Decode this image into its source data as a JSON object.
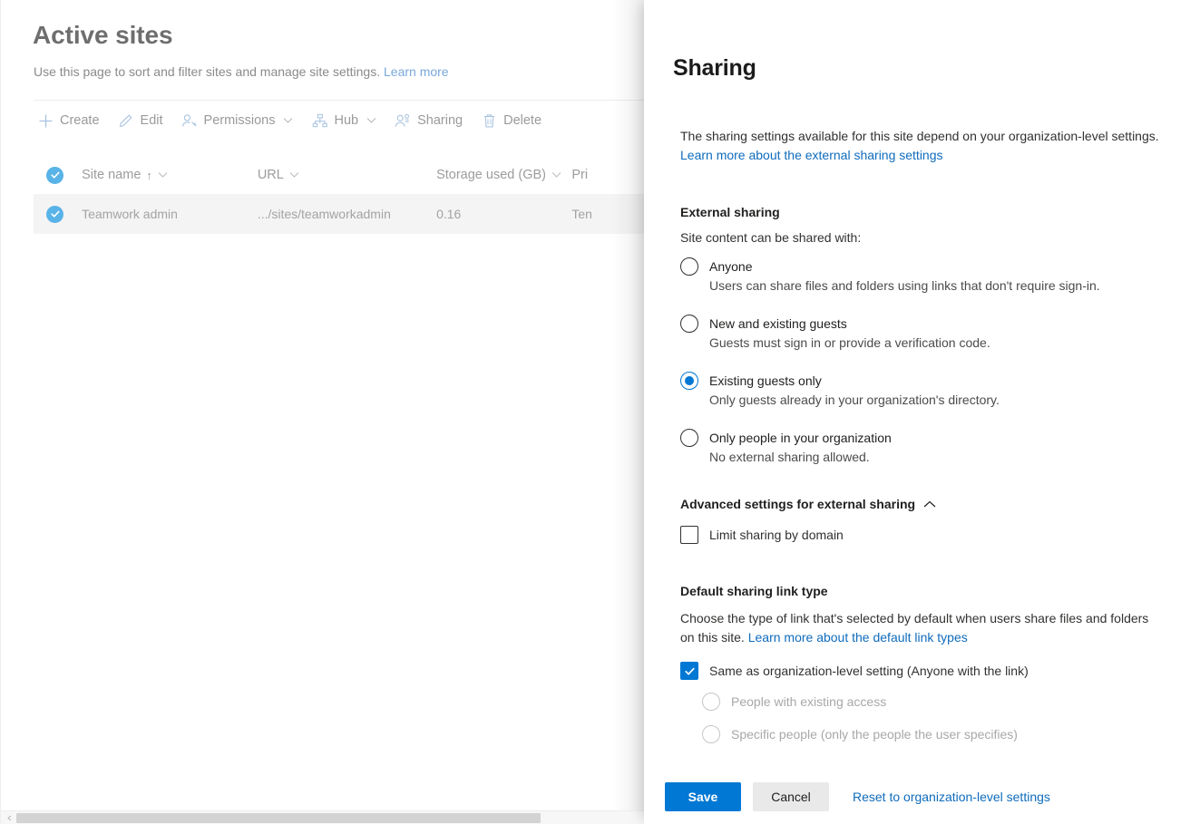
{
  "background": {
    "page_title": "Active sites",
    "subtitle_text": "Use this page to sort and filter sites and manage site settings.",
    "subtitle_link": "Learn more",
    "command_bar": [
      {
        "label": "Create",
        "icon": "plus-icon",
        "has_chevron": false
      },
      {
        "label": "Edit",
        "icon": "pencil-icon",
        "has_chevron": false
      },
      {
        "label": "Permissions",
        "icon": "person-key-icon",
        "has_chevron": true
      },
      {
        "label": "Hub",
        "icon": "hub-icon",
        "has_chevron": true
      },
      {
        "label": "Sharing",
        "icon": "people-share-icon",
        "has_chevron": false
      },
      {
        "label": "Delete",
        "icon": "trash-icon",
        "has_chevron": false
      }
    ],
    "table": {
      "columns": [
        {
          "label": "Site name",
          "sorted": true,
          "sort_arrow": "↑"
        },
        {
          "label": "URL",
          "sorted": false,
          "sort_arrow": ""
        },
        {
          "label": "Storage used (GB)",
          "sorted": false,
          "sort_arrow": ""
        },
        {
          "label": "Pri",
          "sorted": false,
          "sort_arrow": ""
        }
      ],
      "rows": [
        {
          "selected": true,
          "site_name": "Teamwork admin",
          "url": ".../sites/teamworkadmin",
          "storage_used": "0.16",
          "privacy": "Ten"
        }
      ]
    }
  },
  "panel": {
    "title": "Sharing",
    "intro_text": "The sharing settings available for this site depend on your organization-level settings.",
    "intro_link": "Learn more about the external sharing settings",
    "external_sharing": {
      "heading": "External sharing",
      "sub_heading": "Site content can be shared with:",
      "options": [
        {
          "title": "Anyone",
          "description": "Users can share files and folders using links that don't require sign-in.",
          "selected": false
        },
        {
          "title": "New and existing guests",
          "description": "Guests must sign in or provide a verification code.",
          "selected": false
        },
        {
          "title": "Existing guests only",
          "description": "Only guests already in your organization's directory.",
          "selected": true
        },
        {
          "title": "Only people in your organization",
          "description": "No external sharing allowed.",
          "selected": false
        }
      ]
    },
    "advanced": {
      "heading": "Advanced settings for external sharing",
      "expanded": true,
      "chevron": "chevron-up-icon",
      "limit_domain_label": "Limit sharing by domain",
      "limit_domain_checked": false
    },
    "default_link": {
      "heading": "Default sharing link type",
      "description_part1": "Choose the type of link that's selected by default when users share files and folders on this site.",
      "description_link": "Learn more about the default link types",
      "same_as_org_label": "Same as organization-level setting (Anyone with the link)",
      "same_as_org_checked": true,
      "options": [
        {
          "label": "People with existing access",
          "selected": false,
          "disabled": true
        },
        {
          "label": "Specific people (only the people the user specifies)",
          "selected": false,
          "disabled": true
        }
      ]
    },
    "footer": {
      "save_label": "Save",
      "cancel_label": "Cancel",
      "reset_label": "Reset to organization-level settings"
    }
  },
  "colors": {
    "accent": "#0078d4",
    "link": "#0f6cbd",
    "row_select": "#58b3e8",
    "icon_blue": "#b8cfe8"
  }
}
